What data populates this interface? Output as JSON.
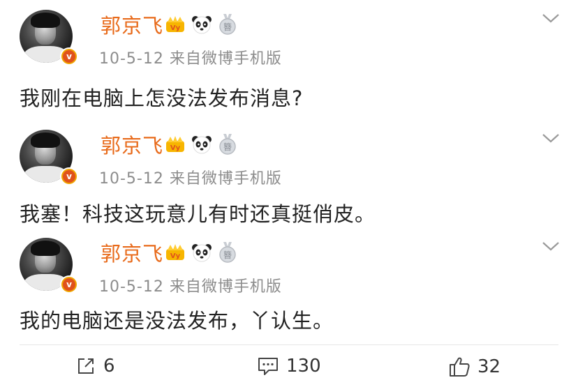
{
  "posts": [
    {
      "author": "郭京飞",
      "meta": "10-5-12  来自微博手机版",
      "content": "我刚在电脑上怎没法发布消息?"
    },
    {
      "author": "郭京飞",
      "meta": "10-5-12  来自微博手机版",
      "content": "我塞！科技这玩意儿有时还真挺俏皮。"
    },
    {
      "author": "郭京飞",
      "meta": "10-5-12  来自微博手机版",
      "content": "我的电脑还是没法发布，丫认生。"
    }
  ],
  "verified_mark": "v",
  "medal_glyph": "簪",
  "actions": {
    "repost_count": "6",
    "comment_count": "130",
    "like_count": "32"
  },
  "icons": {
    "repost": "share-out-icon",
    "comment": "comment-icon",
    "like": "thumbs-up-icon",
    "menu": "chevron-down-icon"
  },
  "colors": {
    "name": "#e86a1a",
    "meta": "#8c8c8c",
    "verified": "#f0a400"
  }
}
